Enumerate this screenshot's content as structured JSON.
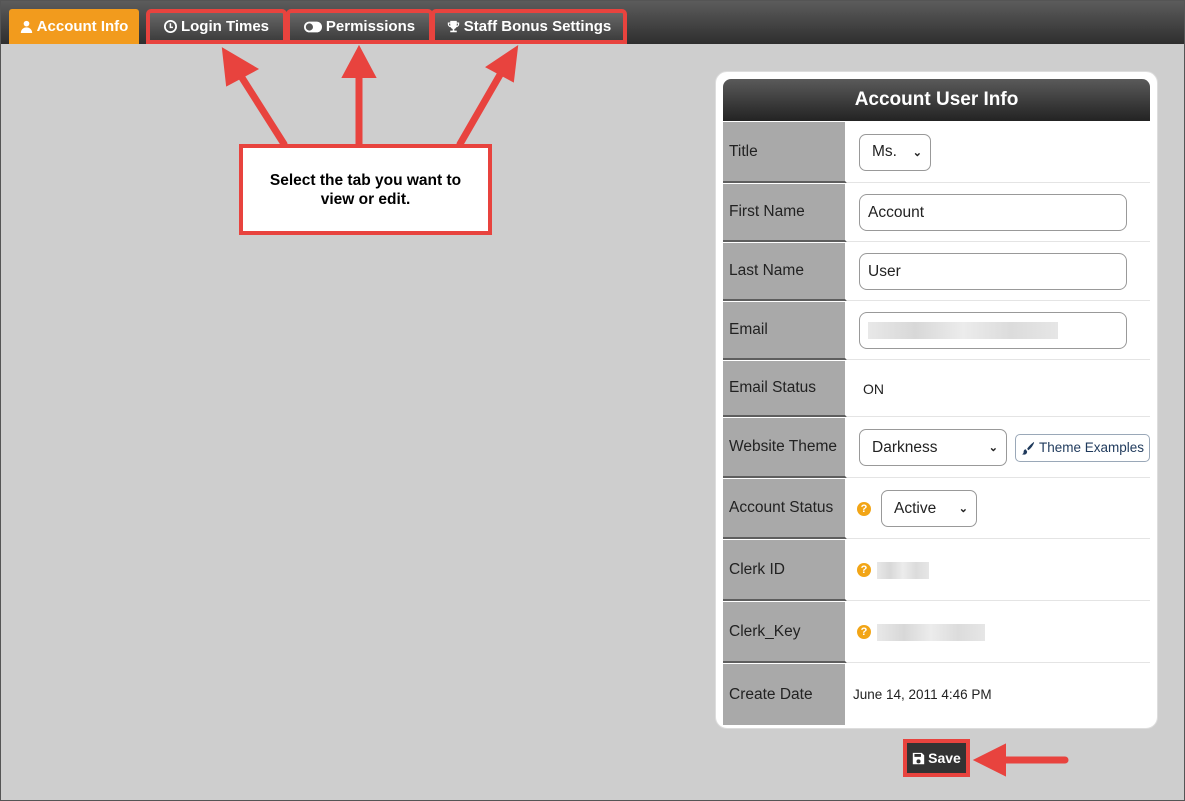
{
  "tabs": [
    {
      "label": "Account Info",
      "icon": "user-icon",
      "active": true
    },
    {
      "label": "Login Times",
      "icon": "clock-icon"
    },
    {
      "label": "Permissions",
      "icon": "toggle-icon"
    },
    {
      "label": "Staff Bonus Settings",
      "icon": "trophy-icon"
    }
  ],
  "callout": {
    "text": "Select the tab you want to view or edit."
  },
  "card": {
    "title": "Account User Info",
    "fields": {
      "title": {
        "label": "Title",
        "value": "Ms."
      },
      "first_name": {
        "label": "First Name",
        "value": "Account"
      },
      "last_name": {
        "label": "Last Name",
        "value": "User"
      },
      "email": {
        "label": "Email",
        "value": ""
      },
      "email_status": {
        "label": "Email Status",
        "value": "ON"
      },
      "website_theme": {
        "label": "Website Theme",
        "value": "Darkness",
        "button": "Theme Examples"
      },
      "account_status": {
        "label": "Account Status",
        "value": "Active"
      },
      "clerk_id": {
        "label": "Clerk ID",
        "value": ""
      },
      "clerk_key": {
        "label": "Clerk_Key",
        "value": ""
      },
      "create_date": {
        "label": "Create Date",
        "value": "June 14, 2011 4:46 PM"
      }
    }
  },
  "save_label": "Save",
  "colors": {
    "accent": "#f29b1d",
    "annotation": "#e8433e"
  }
}
